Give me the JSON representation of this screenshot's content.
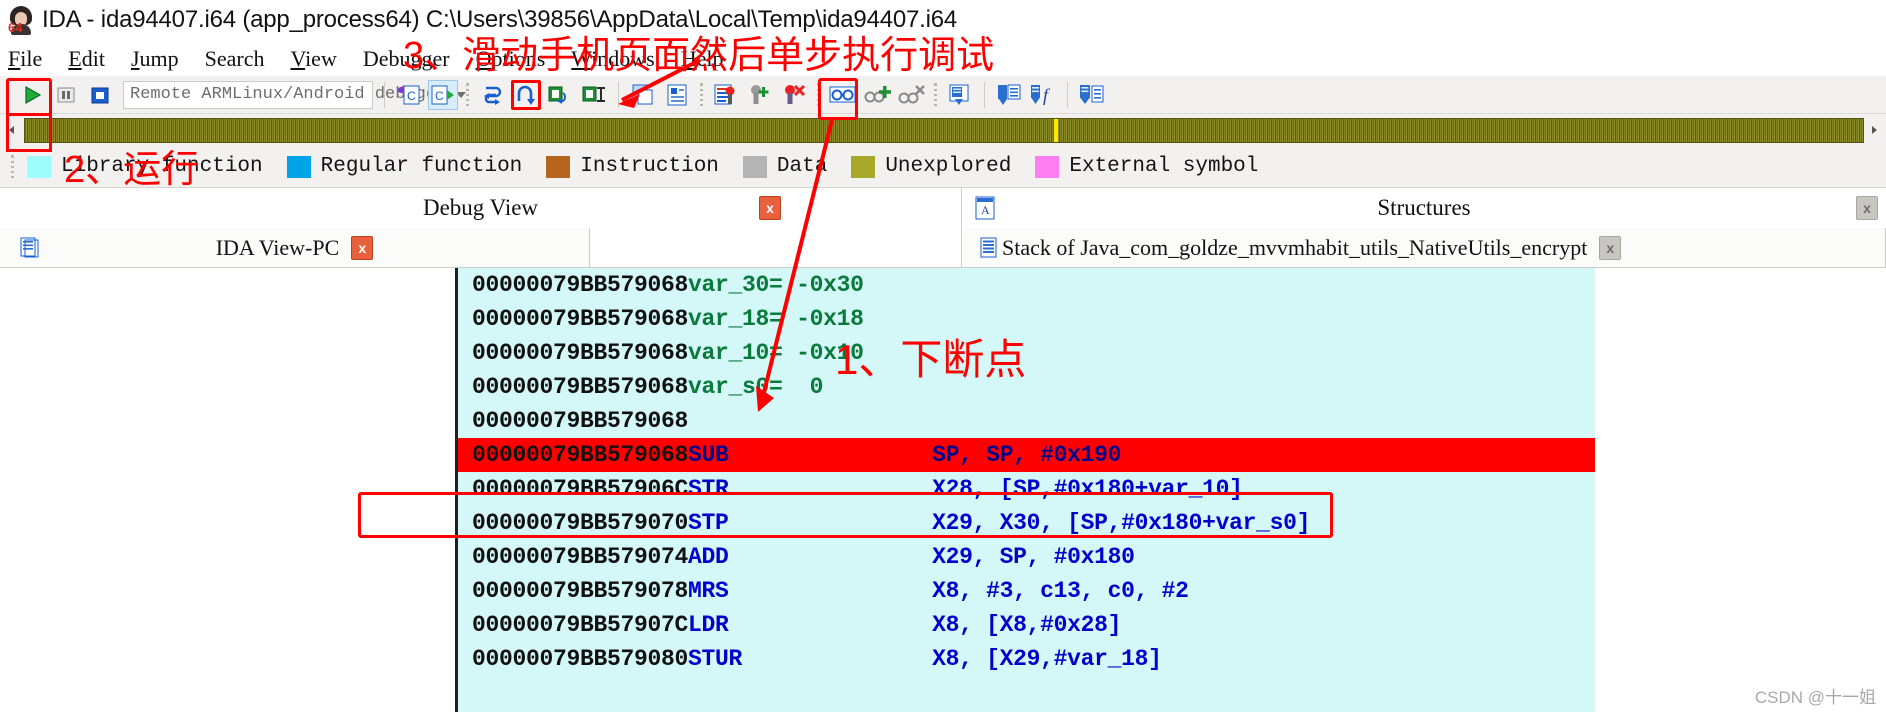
{
  "window": {
    "title": "IDA - ida94407.i64 (app_process64) C:\\Users\\39856\\AppData\\Local\\Temp\\ida94407.i64",
    "icon": "ida-person-icon",
    "icon_badge": "64"
  },
  "menubar": {
    "items": [
      {
        "name": "file",
        "pre": "F",
        "post": "ile"
      },
      {
        "name": "edit",
        "pre": "E",
        "post": "dit"
      },
      {
        "name": "jump",
        "pre": "J",
        "post": "ump"
      },
      {
        "name": "search",
        "pre": "Search",
        "post": ""
      },
      {
        "name": "view",
        "pre": "V",
        "post": "iew"
      },
      {
        "name": "debugger",
        "pre": "Deb",
        "post": "ugger"
      },
      {
        "name": "options",
        "pre": "O",
        "post": "ptions"
      },
      {
        "name": "windows",
        "pre": "W",
        "post": "indows"
      },
      {
        "name": "help",
        "pre": "H",
        "post": "elp"
      }
    ]
  },
  "toolbar": {
    "run_button": "run-debugger-button",
    "pause_button": "pause-button",
    "stop_button": "terminate-button",
    "debugger_selector": {
      "value": "Remote ARMLinux/Android debugger",
      "name": "debugger-type-combo"
    },
    "buttons": [
      {
        "name": "step-into-source-button"
      },
      {
        "name": "run-to-cursor-button"
      },
      {
        "name": "step-into-button"
      },
      {
        "name": "step-over-button"
      },
      {
        "name": "run-until-return-button"
      },
      {
        "name": "step-out-button"
      },
      {
        "name": "open-subviews-button"
      },
      {
        "name": "tile-windows-button"
      },
      {
        "name": "breakpoint-list-button"
      },
      {
        "name": "add-breakpoint-button"
      },
      {
        "name": "delete-breakpoint-button"
      },
      {
        "name": "watch-view-button"
      },
      {
        "name": "add-watch-button"
      },
      {
        "name": "delete-watch-button"
      },
      {
        "name": "stack-trace-button"
      },
      {
        "name": "module-list-button"
      },
      {
        "name": "function-list-button"
      },
      {
        "name": "thread-list-button"
      }
    ]
  },
  "legend": {
    "items": [
      {
        "label": "Library function",
        "color": "#9ffcfc"
      },
      {
        "label": "Regular function",
        "color": "#00a2e8"
      },
      {
        "label": "Instruction",
        "color": "#b5651d"
      },
      {
        "label": "Data",
        "color": "#b4b4b4"
      },
      {
        "label": "Unexplored",
        "color": "#a8a82b"
      },
      {
        "label": "External symbol",
        "color": "#ff7ef0"
      }
    ]
  },
  "panels": {
    "left": {
      "title": "Debug View",
      "close": "x"
    },
    "right": {
      "title": "Structures",
      "close": "x",
      "icon": "structures-icon"
    }
  },
  "tabs": [
    {
      "name": "tab-ida-view-pc",
      "label": "IDA View-PC",
      "icon": "view-icon",
      "close": "x",
      "close_style": "red"
    },
    {
      "name": "tab-stack-of-native-utils",
      "label": "Stack of Java_com_goldze_mvvmhabit_utils_NativeUtils_encrypt",
      "icon": "stack-icon",
      "close": "x",
      "close_style": "grey"
    }
  ],
  "disassembly": {
    "lines": [
      {
        "addr": "00000079BB579068",
        "mnemonic": "",
        "var": "var_30=",
        "ops": "-0x30",
        "highlight": false,
        "kind": "var"
      },
      {
        "addr": "00000079BB579068",
        "mnemonic": "",
        "var": "var_18=",
        "ops": "-0x18",
        "highlight": false,
        "kind": "var"
      },
      {
        "addr": "00000079BB579068",
        "mnemonic": "",
        "var": "var_10=",
        "ops": "-0x10",
        "highlight": false,
        "kind": "var"
      },
      {
        "addr": "00000079BB579068",
        "mnemonic": "",
        "var": "var_s0=",
        "ops": " 0",
        "highlight": false,
        "kind": "var"
      },
      {
        "addr": "00000079BB579068",
        "mnemonic": "",
        "var": "",
        "ops": "",
        "highlight": false,
        "kind": "blank"
      },
      {
        "addr": "00000079BB579068",
        "mnemonic": "SUB",
        "var": "",
        "ops": "SP, SP, #0x190",
        "highlight": true,
        "kind": "insn"
      },
      {
        "addr": "00000079BB57906C",
        "mnemonic": "STR",
        "var": "",
        "ops": "X28, [SP,#0x180+var_10]",
        "highlight": false,
        "kind": "insn"
      },
      {
        "addr": "00000079BB579070",
        "mnemonic": "STP",
        "var": "",
        "ops": "X29, X30, [SP,#0x180+var_s0]",
        "highlight": false,
        "kind": "insn"
      },
      {
        "addr": "00000079BB579074",
        "mnemonic": "ADD",
        "var": "",
        "ops": "X29, SP, #0x180",
        "highlight": false,
        "kind": "insn"
      },
      {
        "addr": "00000079BB579078",
        "mnemonic": "MRS",
        "var": "",
        "ops": "X8, #3, c13, c0, #2",
        "highlight": false,
        "kind": "insn"
      },
      {
        "addr": "00000079BB57907C",
        "mnemonic": "LDR",
        "var": "",
        "ops": "X8, [X8,#0x28]",
        "highlight": false,
        "kind": "insn"
      },
      {
        "addr": "00000079BB579080",
        "mnemonic": "STUR",
        "var": "",
        "ops": "X8, [X29,#var_18]",
        "highlight": false,
        "kind": "insn"
      }
    ]
  },
  "annotations": [
    {
      "name": "annotation-breakpoint",
      "text": "1、下断点",
      "color": "#fe0000"
    },
    {
      "name": "annotation-run",
      "text": "2、运行",
      "color": "#fe0000"
    },
    {
      "name": "annotation-step-debug",
      "text": "3、滑动手机页面然后单步执行调试",
      "color": "#fe0000"
    }
  ],
  "watermark": "CSDN @十一姐"
}
